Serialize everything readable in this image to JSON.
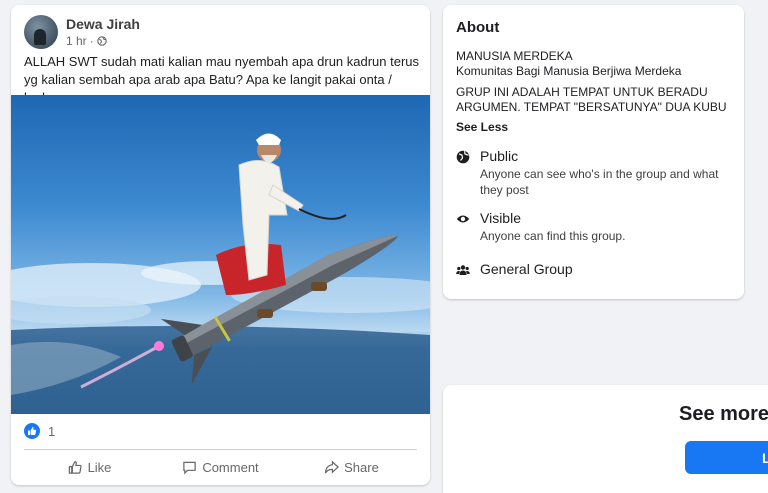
{
  "post": {
    "author": "Dewa Jirah",
    "time": "1 hr",
    "privacy_icon": "globe-icon",
    "text": "ALLAH SWT sudah mati kalian mau nyembah apa drun kadrun  terus yg kalian sembah apa  arab apa Batu? Apa ke langit pakai onta / kuda",
    "like_count": "1",
    "actions": {
      "like": "Like",
      "comment": "Comment",
      "share": "Share"
    }
  },
  "about": {
    "title": "About",
    "desc_line1": "MANUSIA MERDEKA",
    "desc_line2": "Komunitas Bagi Manusia Berjiwa Merdeka",
    "desc_line3": "GRUP INI ADALAH TEMPAT UNTUK BERADU ARGUMEN. TEMPAT \"BERSATUNYA\" DUA KUBU",
    "see_less": "See Less",
    "public_label": "Public",
    "public_sub": "Anyone can see who's in the group and what they post",
    "visible_label": "Visible",
    "visible_sub": "Anyone can find this group.",
    "general_label": "General Group"
  },
  "promo": {
    "title": "See more",
    "button": "L"
  },
  "colors": {
    "accent": "#1877f2",
    "background": "#f0f2f5"
  }
}
